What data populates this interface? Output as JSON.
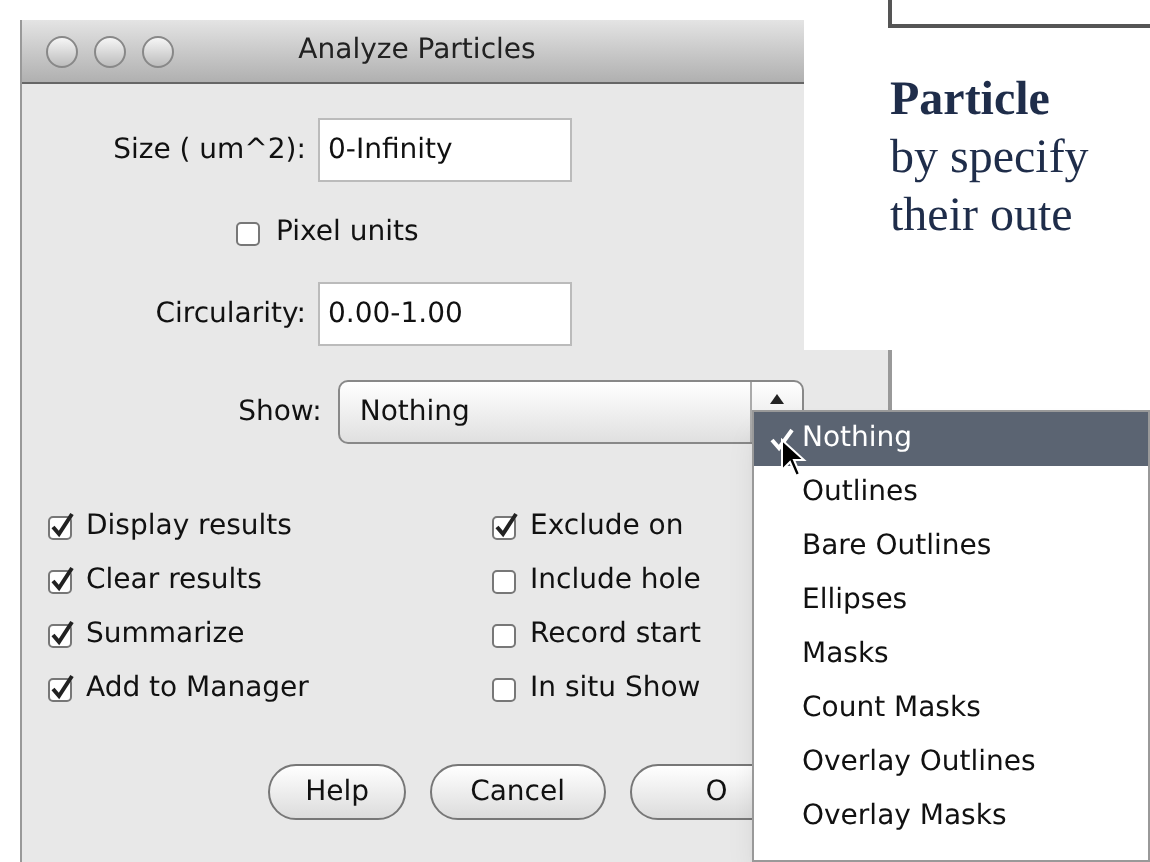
{
  "dialog": {
    "title": "Analyze Particles",
    "fields": [
      {
        "label": "Size ( um^2):",
        "value": "0-Infinity"
      },
      {
        "label": "Circularity:",
        "value": "0.00-1.00"
      }
    ],
    "pixel_units": {
      "label": "Pixel units",
      "checked": false
    },
    "show": {
      "label": "Show:",
      "value": "Nothing"
    },
    "options_left": [
      {
        "label": "Display results",
        "checked": true
      },
      {
        "label": "Clear results",
        "checked": true
      },
      {
        "label": "Summarize",
        "checked": true
      },
      {
        "label": "Add to Manager",
        "checked": true
      }
    ],
    "options_right": [
      {
        "label": "Exclude on",
        "checked": true
      },
      {
        "label": "Include hole",
        "checked": false
      },
      {
        "label": "Record start",
        "checked": false
      },
      {
        "label": "In situ Show",
        "checked": false
      }
    ],
    "buttons": [
      "Help",
      "Cancel",
      "O"
    ]
  },
  "document": {
    "heading": "Particle",
    "lines": [
      "by specify",
      "their oute"
    ]
  },
  "show_menu": {
    "items": [
      {
        "label": "Nothing",
        "selected": true
      },
      {
        "label": "Outlines",
        "selected": false
      },
      {
        "label": "Bare Outlines",
        "selected": false
      },
      {
        "label": "Ellipses",
        "selected": false
      },
      {
        "label": "Masks",
        "selected": false
      },
      {
        "label": "Count Masks",
        "selected": false
      },
      {
        "label": "Overlay Outlines",
        "selected": false
      },
      {
        "label": "Overlay Masks",
        "selected": false
      }
    ]
  }
}
